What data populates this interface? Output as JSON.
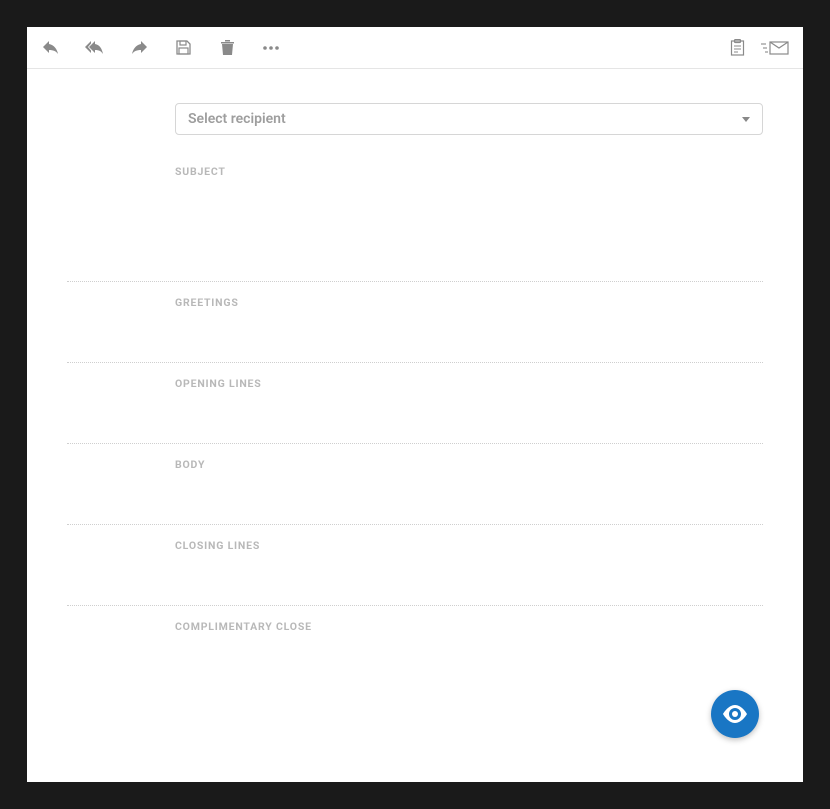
{
  "toolbar": {
    "reply_icon": "reply",
    "reply_all_icon": "reply-all",
    "forward_icon": "forward",
    "save_icon": "save",
    "delete_icon": "delete",
    "more_icon": "more",
    "clipboard_icon": "clipboard",
    "send_icon": "send-mail"
  },
  "recipient": {
    "placeholder": "Select recipient"
  },
  "sections": {
    "subject": "SUBJECT",
    "greetings": "GREETINGS",
    "opening_lines": "OPENING LINES",
    "body": "BODY",
    "closing_lines": "CLOSING LINES",
    "complimentary_close": "COMPLIMENTARY CLOSE"
  },
  "fab": {
    "icon": "preview-eye"
  },
  "colors": {
    "accent": "#1976c4",
    "label_muted": "#b8b8b8",
    "icon_muted": "#8a8a8a",
    "border": "#d6d6d6"
  }
}
